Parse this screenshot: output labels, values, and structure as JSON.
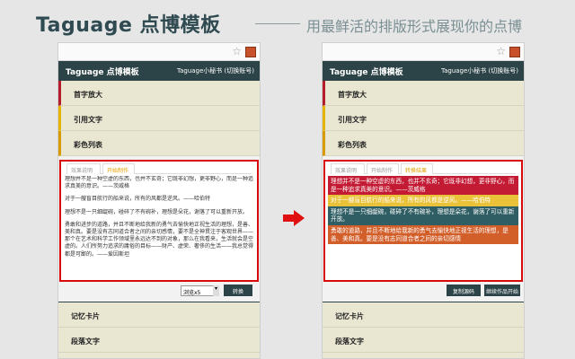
{
  "banner": {
    "brand": "Taguage 点博模板",
    "slogan": "用最鲜活的排版形式展现你的点博"
  },
  "app": {
    "title": "Taguage 点博模板",
    "account_left": "Taguage小秘书 (切换账号)",
    "account_right": "Taguage小秘书 (切换账号)"
  },
  "menu": {
    "items": [
      "首字放大",
      "引用文字",
      "彩色列表"
    ],
    "bottom": [
      "记忆卡片",
      "段落文字"
    ]
  },
  "tabs": [
    "效果说明",
    "开始制作",
    "转换结果"
  ],
  "left_editor": {
    "paragraphs": [
      "理想并不是一种空虚的东西，也并不玄奇；它既非幻想，更非野心，而是一种追求真美的意识。——茨威格",
      "对于一艘盲目航行的船来说，所有的风都是逆风。——哈伯特",
      "理想不是一只细龊碗，碰碎了不有碗补，理想是朵花，谢落了可以重新开放。",
      "勇敢和进步的道路，并且不断地给我新的勇气去愉快地正视生活的理想，是善、美和真。要是没有志同道合者之间的亲切感情，要不是全神贯注于客观世界——那个在艺术和科学工作领域里永远达不到的对象，那么在我看来，生活就会是空虚的。人们所努力追求的庸俗的目标——财产、虚荣、奢侈的生活——我总觉得都是可鄙的。——爱因斯坦"
    ]
  },
  "controls": {
    "select_value": "浏览x5",
    "convert_label": "转换",
    "copy_label": "复制源码",
    "back_label": "继续作品开始"
  },
  "right_result": {
    "blocks": [
      "理想并不是一种空虚的东西，也并不玄奇；它既非幻想，更非野心，而是一种追求真美的意识。——茨威格",
      "对于一艘盲目航行的船来说，所有的风都是逆风。——哈伯特",
      "理想不是一只细龊碗，碰碎了不有碗补，理想是朵花，谢落了可以重新开放。",
      "勇敢的道路，并且不断地给我新的勇气去愉快地正视生活的理想，是善、美和真。要是没有志同道合者之间的亲切感情"
    ]
  },
  "colors": {
    "header": "#2c4347",
    "accent_red": "#d80b0b",
    "block_red": "#c41b35",
    "block_yellow": "#e9c23a",
    "block_teal": "#2f5e64",
    "block_orange": "#d25e29"
  }
}
